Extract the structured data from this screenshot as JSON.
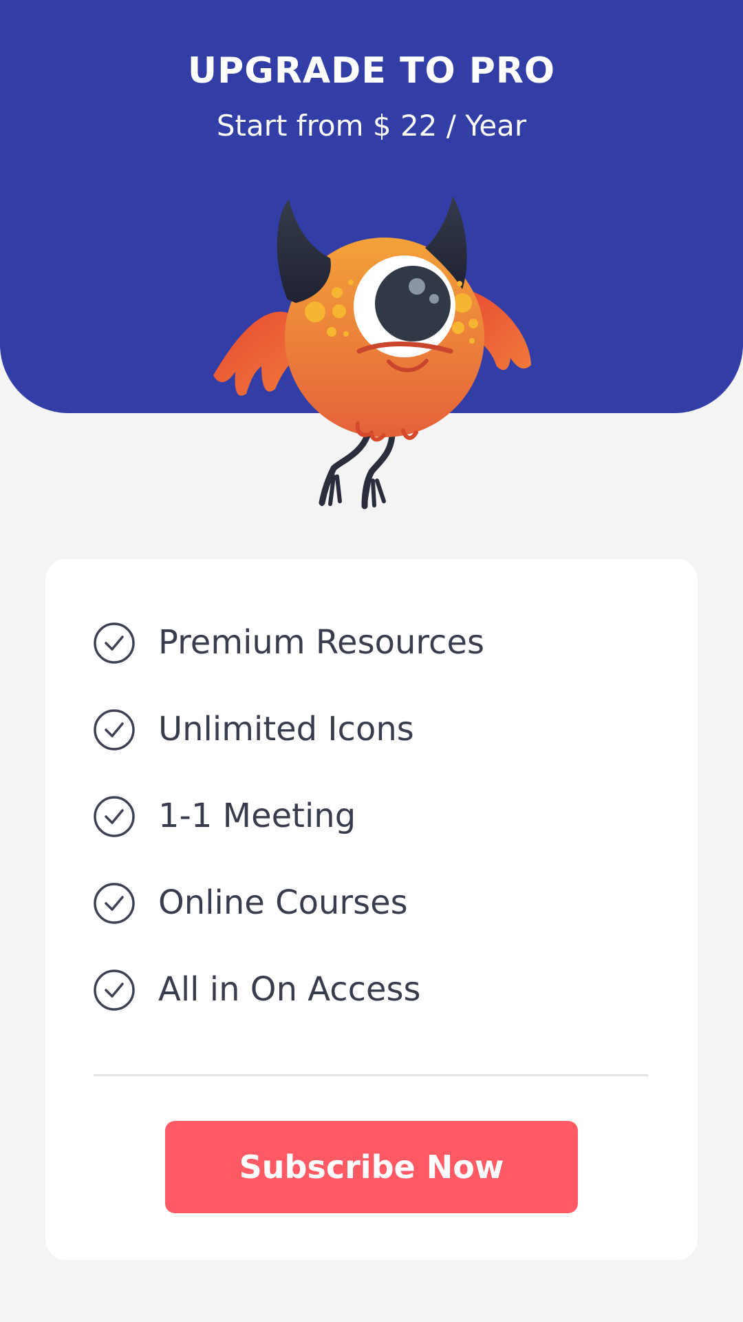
{
  "header": {
    "title": "UPGRADE TO PRO",
    "subtitle": "Start from $ 22 / Year"
  },
  "mascot": {
    "icon": "one-eyed-monster-icon"
  },
  "features": {
    "icon": "check-circle-icon",
    "items": [
      {
        "label": "Premium Resources"
      },
      {
        "label": "Unlimited Icons"
      },
      {
        "label": "1-1 Meeting"
      },
      {
        "label": "Online Courses"
      },
      {
        "label": "All in On Access"
      }
    ]
  },
  "cta": {
    "label": "Subscribe Now"
  },
  "colors": {
    "brand": "#323da6",
    "accent": "#ff5a64",
    "background": "#f4f4f4",
    "text": "#393c4d"
  }
}
